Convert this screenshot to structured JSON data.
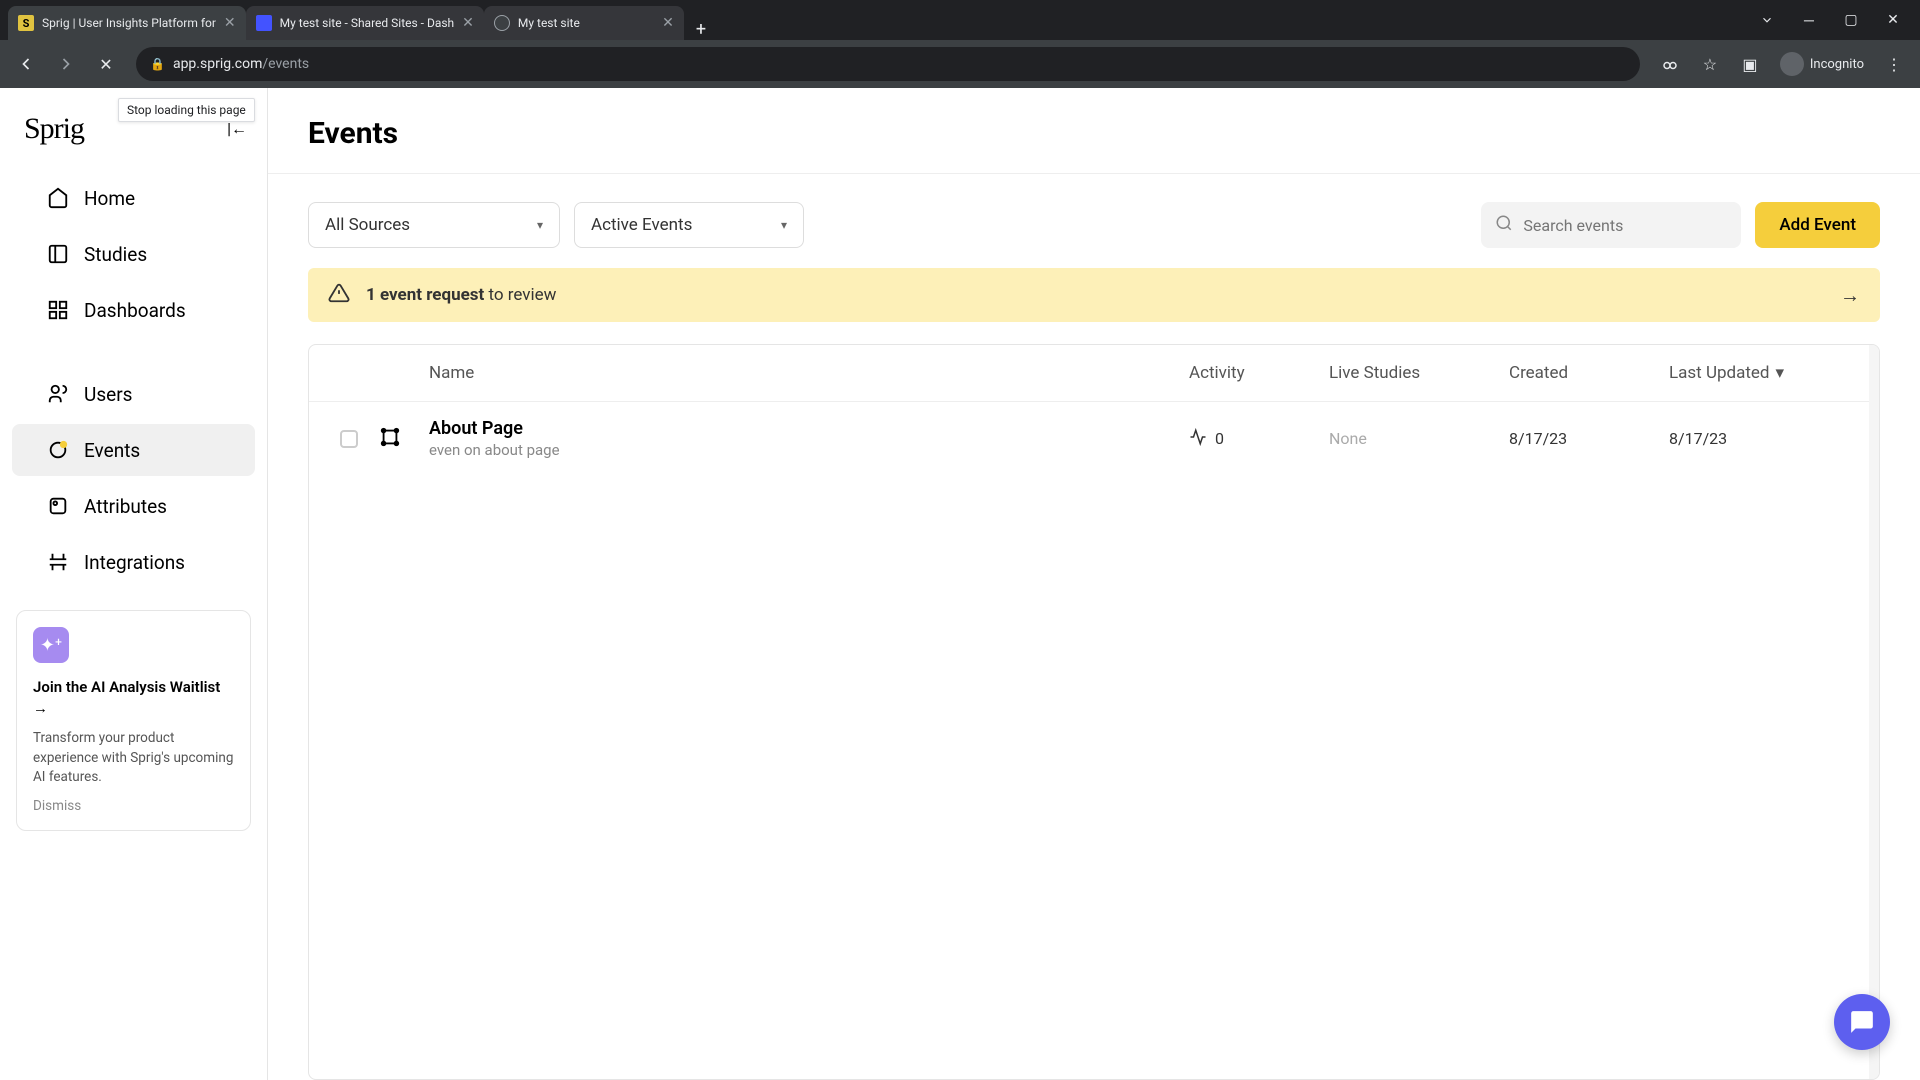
{
  "browser": {
    "tabs": [
      {
        "title": "Sprig | User Insights Platform for"
      },
      {
        "title": "My test site - Shared Sites - Dash"
      },
      {
        "title": "My test site"
      }
    ],
    "url_host": "app.sprig.com",
    "url_path": "/events",
    "tooltip": "Stop loading this page",
    "incognito": "Incognito"
  },
  "sidebar": {
    "logo": "Sprig",
    "items": [
      "Home",
      "Studies",
      "Dashboards",
      "Users",
      "Events",
      "Attributes",
      "Integrations"
    ],
    "promo": {
      "title": "Join the AI Analysis Waitlist →",
      "body": "Transform your product experience with Sprig's upcoming AI features.",
      "dismiss": "Dismiss"
    }
  },
  "page": {
    "title": "Events",
    "filter_sources": "All Sources",
    "filter_status": "Active Events",
    "search_placeholder": "Search events",
    "add_button": "Add Event",
    "banner_bold": "1 event request",
    "banner_rest": " to review",
    "columns": {
      "name": "Name",
      "activity": "Activity",
      "live": "Live Studies",
      "created": "Created",
      "updated": "Last Updated"
    },
    "rows": [
      {
        "name": "About Page",
        "desc": "even on about page",
        "activity": "0",
        "live": "None",
        "created": "8/17/23",
        "updated": "8/17/23"
      }
    ]
  }
}
